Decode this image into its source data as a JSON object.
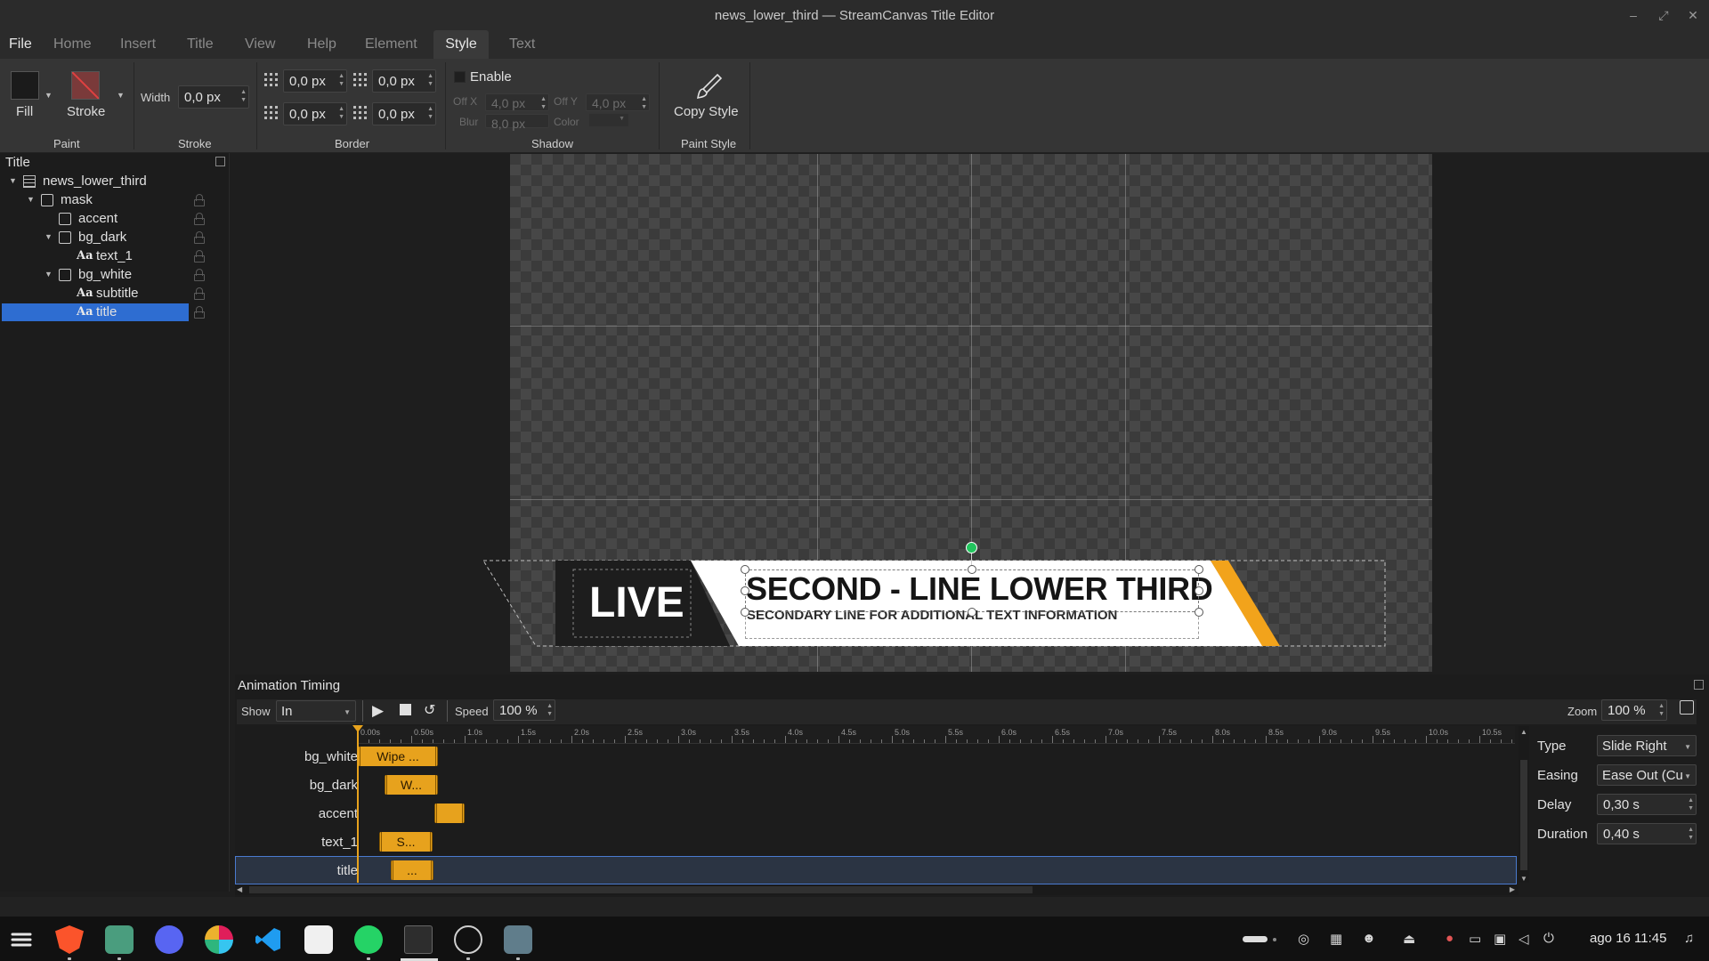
{
  "window": {
    "title": "news_lower_third — StreamCanvas Title Editor"
  },
  "menu": [
    "File",
    "Home",
    "Insert",
    "Title",
    "View",
    "Help",
    "Element",
    "Style",
    "Text"
  ],
  "ribbon": {
    "paint": {
      "fill_label": "Fill",
      "stroke_label": "Stroke",
      "group_label": "Paint"
    },
    "stroke": {
      "width_label": "Width",
      "width_value": "0,0 px",
      "group_label": "Stroke"
    },
    "border": {
      "v1": "0,0 px",
      "v2": "0,0 px",
      "v3": "0,0 px",
      "v4": "0,0 px",
      "group_label": "Border"
    },
    "shadow": {
      "enable_label": "Enable",
      "offx_label": "Off X",
      "offx_value": "4,0 px",
      "offy_label": "Off Y",
      "offy_value": "4,0 px",
      "blur_label": "Blur",
      "blur_value": "8,0 px",
      "color_label": "Color",
      "group_label": "Shadow"
    },
    "paint_style": {
      "copy_label": "Copy Style",
      "group_label": "Paint Style"
    }
  },
  "tree": {
    "panel_title": "Title",
    "items": [
      {
        "label": "news_lower_third",
        "kind": "title"
      },
      {
        "label": "mask",
        "kind": "group"
      },
      {
        "label": "accent",
        "kind": "shape"
      },
      {
        "label": "bg_dark",
        "kind": "group"
      },
      {
        "label": "text_1",
        "kind": "text"
      },
      {
        "label": "bg_white",
        "kind": "group"
      },
      {
        "label": "subtitle",
        "kind": "text"
      },
      {
        "label": "title",
        "kind": "text",
        "selected": true
      }
    ],
    "text_glyph": "Aa"
  },
  "canvas": {
    "live_text": "LIVE",
    "headline": "SECOND - LINE LOWER THIRD",
    "subline": "SECONDARY LINE FOR ADDITIONAL TEXT INFORMATION",
    "colors": {
      "accent": "#f2a31b",
      "dark": "#1d1d1d",
      "white": "#ffffff",
      "rotate_handle": "#22c55e"
    }
  },
  "timing": {
    "panel_title": "Animation Timing",
    "show_label": "Show",
    "show_value": "In",
    "speed_label": "Speed",
    "speed_value": "100 %",
    "zoom_label": "Zoom",
    "zoom_value": "100 %",
    "ruler": [
      "0.00s",
      "0.50s",
      "1.0s",
      "1.5s",
      "2.0s",
      "2.5s",
      "3.0s",
      "3.5s",
      "4.0s",
      "4.5s",
      "5.0s",
      "5.5s",
      "6.0s",
      "6.5s",
      "7.0s",
      "7.5s",
      "8.0s",
      "8.5s",
      "9.0s",
      "9.5s",
      "10.0s",
      "10.5s"
    ],
    "tracks": [
      {
        "name": "bg_white",
        "clip": "Wipe ...",
        "start_s": 0.0,
        "end_s": 0.75
      },
      {
        "name": "bg_dark",
        "clip": "W...",
        "start_s": 0.25,
        "end_s": 0.75
      },
      {
        "name": "accent",
        "clip": "",
        "start_s": 0.72,
        "end_s": 1.0
      },
      {
        "name": "text_1",
        "clip": "S...",
        "start_s": 0.2,
        "end_s": 0.7
      },
      {
        "name": "title",
        "clip": "...",
        "start_s": 0.3,
        "end_s": 0.7,
        "selected": true
      }
    ],
    "props": {
      "type_label": "Type",
      "type_value": "Slide Right",
      "easing_label": "Easing",
      "easing_value": "Ease Out (Cu",
      "delay_label": "Delay",
      "delay_value": "0,30 s",
      "duration_label": "Duration",
      "duration_value": "0,40 s"
    }
  },
  "taskbar": {
    "apps": [
      "zorin-menu",
      "brave",
      "files",
      "discord",
      "slack",
      "vscode",
      "dev-tool",
      "whatsapp",
      "terminal",
      "obs",
      "settings"
    ],
    "clock": "ago 16  11:45"
  }
}
